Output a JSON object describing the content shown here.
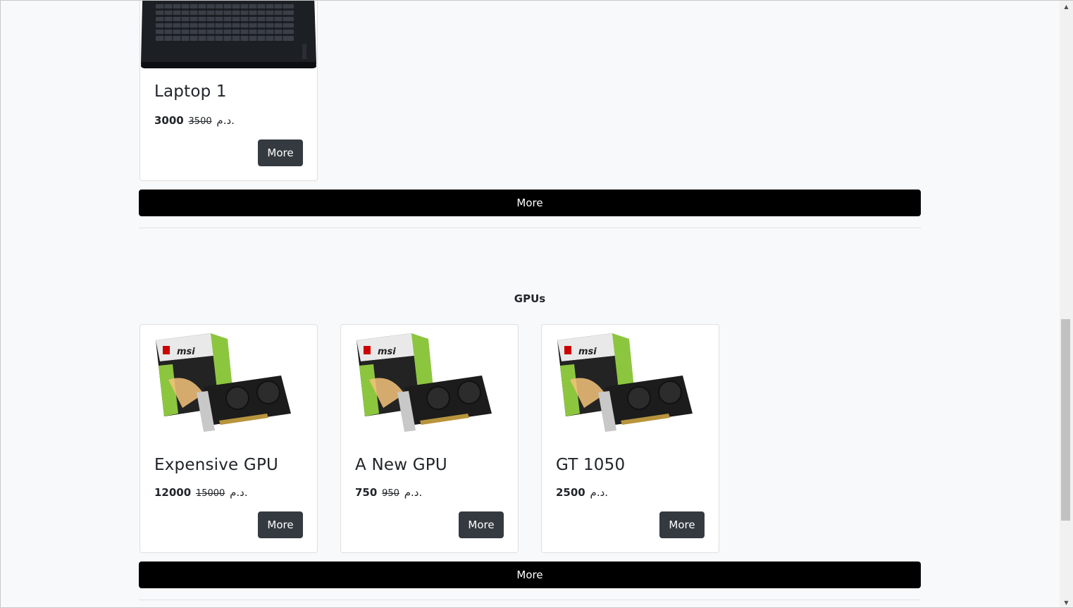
{
  "laptops": {
    "cards": [
      {
        "title": "Laptop 1",
        "price": "3000",
        "old_price": "3500",
        "currency": "د.م.",
        "button": "More"
      }
    ],
    "more_button": "More"
  },
  "gpus": {
    "title": "GPUs",
    "cards": [
      {
        "title": "Expensive GPU",
        "price": "12000",
        "old_price": "15000",
        "currency": "د.م.",
        "button": "More"
      },
      {
        "title": "A New GPU",
        "price": "750",
        "old_price": "950",
        "currency": "د.م.",
        "button": "More"
      },
      {
        "title": "GT 1050",
        "price": "2500",
        "old_price": "",
        "currency": "د.م.",
        "button": "More"
      }
    ],
    "more_button": "More"
  },
  "icons": {
    "scroll_up": "scroll-up-arrow-icon",
    "scroll_down": "scroll-down-arrow-icon"
  },
  "colors": {
    "page_bg": "#f8f9fa",
    "card_button": "#343a40",
    "wide_button": "#000000"
  }
}
